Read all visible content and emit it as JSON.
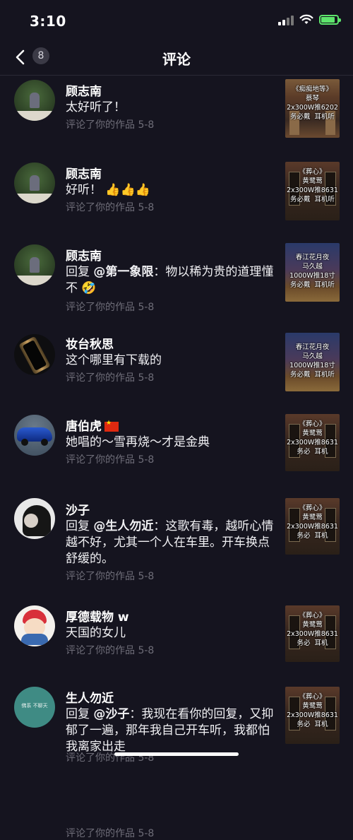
{
  "status": {
    "time": "3:10"
  },
  "nav": {
    "title": "评论",
    "count": "8"
  },
  "comments": [
    {
      "name": "顾志南",
      "text": "太好听了！",
      "meta": "评论了你的作品  5-8",
      "thumb": "《痴痴地等》\n蔡琴\n2x300W推6202\n务必戴  耳机听"
    },
    {
      "name": "顾志南",
      "text": "好听！",
      "emoji": "👍👍👍",
      "meta": "评论了你的作品  5-8",
      "thumb": "《葬心》\n黄鹭莺\n2x300W推8631\n务必戴  耳机听"
    },
    {
      "name": "顾志南",
      "reply_prefix": "回复",
      "mention": "@第一象限",
      "text": "：物以稀为贵的道理懂不",
      "emoji": "🤣",
      "meta": "评论了你的作品  5-8",
      "thumb": "春江花月夜\n马久越\n1000W推18寸\n务必戴  耳机听"
    },
    {
      "name": "妆台秋思",
      "text": "这个哪里有下载的",
      "meta": "评论了你的作品  5-8",
      "thumb": "春江花月夜\n马久越\n1000W推18寸\n务必戴  耳机听"
    },
    {
      "name": "唐伯虎",
      "flag": "🇨🇳",
      "text": "她唱的～雪再烧～才是金典",
      "meta": "评论了你的作品  5-8",
      "thumb": "《葬心》\n黄鹭莺\n2x300W推8631\n务必  耳机"
    },
    {
      "name": "沙子",
      "reply_prefix": "回复",
      "mention": "@生人勿近",
      "text": "：这歌有毒，越听心情越不好，尤其一个人在车里。开车换点舒缓的。",
      "meta": "评论了你的作品  5-8",
      "thumb": "《葬心》\n黄鹭莺\n2x300W推8631\n务必  耳机"
    },
    {
      "name": "厚德载物 w",
      "text": "天国的女儿",
      "meta": "评论了你的作品  5-8",
      "thumb": "《葬心》\n黄鹭莺\n2x300W推8631\n务必  耳机"
    },
    {
      "name": "生人勿近",
      "reply_prefix": "回复",
      "mention": "@沙子",
      "text": "：我现在看你的回复，又抑郁了一遍，那年我自己开车听，我都怕我离家出走",
      "meta": "评论了你的作品  5-8",
      "thumb": "《葬心》\n黄鹭莺\n2x300W推8631\n务必  耳机",
      "avatar_text": "佛系  不聊天"
    }
  ]
}
